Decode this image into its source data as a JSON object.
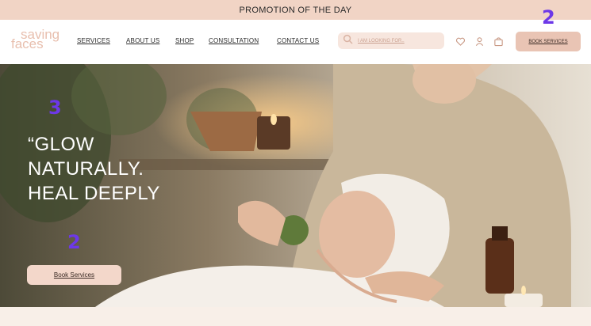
{
  "promo": {
    "text": "PROMOTION OF THE DAY"
  },
  "logo": {
    "line1": "saving",
    "line2": "faces"
  },
  "nav": {
    "links": [
      "SERVICES",
      "ABOUT US",
      "SHOP",
      "CONSULTATION",
      "CONTACT US"
    ],
    "search_placeholder": "I AM LOOKING FOR..",
    "book_label": "BOOK SERVICES"
  },
  "icons": {
    "search": "search-icon",
    "wishlist": "heart-icon",
    "account": "user-icon",
    "cart": "bag-icon"
  },
  "markers": {
    "nav_book": "2",
    "headline": "3",
    "hero_book": "2"
  },
  "hero": {
    "headline": [
      "“GLOW",
      "NATURALLY.",
      "HEAL DEEPLY"
    ],
    "book_label": "Book Services"
  },
  "colors": {
    "accent": "#e9c4b4",
    "promo_bg": "#f1d4c5",
    "marker": "#6d38e8",
    "logo": "#e8bfae"
  }
}
